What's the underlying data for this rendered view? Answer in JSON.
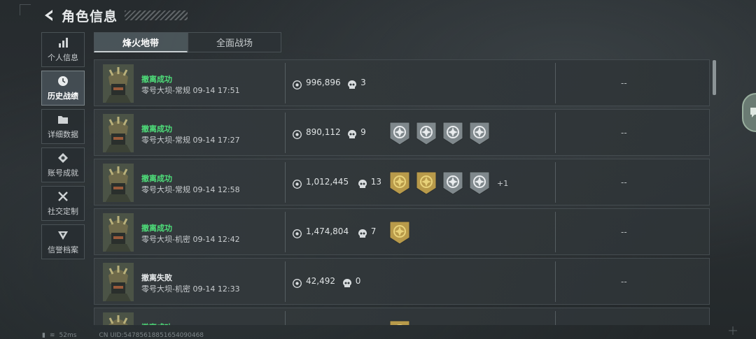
{
  "header": {
    "title": "角色信息"
  },
  "side_nav": [
    {
      "label": "个人信息",
      "icon": "bar-chart-icon",
      "active": false
    },
    {
      "label": "历史战绩",
      "icon": "clock-icon",
      "active": true
    },
    {
      "label": "详细数据",
      "icon": "folder-icon",
      "active": false
    },
    {
      "label": "账号成就",
      "icon": "medal-icon",
      "active": false
    },
    {
      "label": "社交定制",
      "icon": "tools-icon",
      "active": false
    },
    {
      "label": "信誉档案",
      "icon": "shield-icon",
      "active": false
    }
  ],
  "tabs": [
    {
      "label": "烽火地带",
      "active": true
    },
    {
      "label": "全面战场",
      "active": false
    }
  ],
  "records": [
    {
      "status": "撤离成功",
      "result": "success",
      "map": "零号大坝-常规 09-14 17:51",
      "value": "996,896",
      "kills": "3",
      "badges": [],
      "more": "",
      "extra": "--"
    },
    {
      "status": "撤离成功",
      "result": "success",
      "map": "零号大坝-常规 09-14 17:27",
      "value": "890,112",
      "kills": "9",
      "badges": [
        "silver",
        "silver",
        "silver",
        "silver"
      ],
      "more": "",
      "extra": "--"
    },
    {
      "status": "撤离成功",
      "result": "success",
      "map": "零号大坝-常规 09-14 12:58",
      "value": "1,012,445",
      "kills": "13",
      "badges": [
        "gold",
        "gold",
        "silver",
        "silver"
      ],
      "more": "+1",
      "extra": "--"
    },
    {
      "status": "撤离成功",
      "result": "success",
      "map": "零号大坝-机密 09-14 12:42",
      "value": "1,474,804",
      "kills": "7",
      "badges": [
        "gold"
      ],
      "more": "",
      "extra": "--"
    },
    {
      "status": "撤离失败",
      "result": "fail",
      "map": "零号大坝-机密 09-14 12:33",
      "value": "42,492",
      "kills": "0",
      "badges": [],
      "more": "",
      "extra": "--"
    },
    {
      "status": "撤离成功",
      "result": "success",
      "map": "",
      "value": "",
      "kills": "",
      "badges": [
        "gold"
      ],
      "more": "",
      "extra": ""
    }
  ],
  "footer": {
    "ping": "52ms",
    "uid": "CN UID:547856188516540904​68"
  },
  "colors": {
    "success": "#4ee07a",
    "fail": "#e8ebec",
    "gold": "#b89a4a",
    "silver": "#7f888c"
  }
}
